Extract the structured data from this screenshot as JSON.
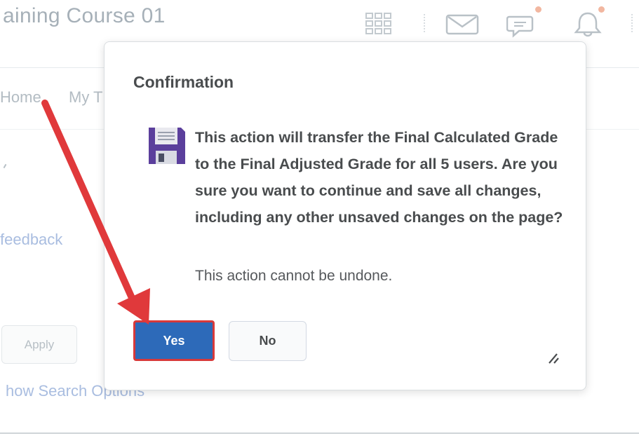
{
  "header": {
    "course_title": "aining Course 01",
    "icons": [
      "app-grid-icon",
      "mail-icon",
      "chat-icon",
      "bell-icon"
    ]
  },
  "nav": {
    "home_label": "Home",
    "my_label": "My T"
  },
  "background": {
    "feedback_link": "feedback",
    "apply_button": "Apply",
    "search_options_link": "how Search Options"
  },
  "dialog": {
    "title": "Confirmation",
    "icon": "floppy-disk-icon",
    "message": "This action will transfer the Final Calculated Grade to the Final Adjusted Grade for all 5 users. Are you sure you want to continue and save all changes, including any other unsaved changes on the page?",
    "note": "This action cannot be undone.",
    "yes_label": "Yes",
    "no_label": "No"
  },
  "colors": {
    "primary": "#2d6ab9",
    "highlight": "#d8393a",
    "text": "#494c4e"
  }
}
